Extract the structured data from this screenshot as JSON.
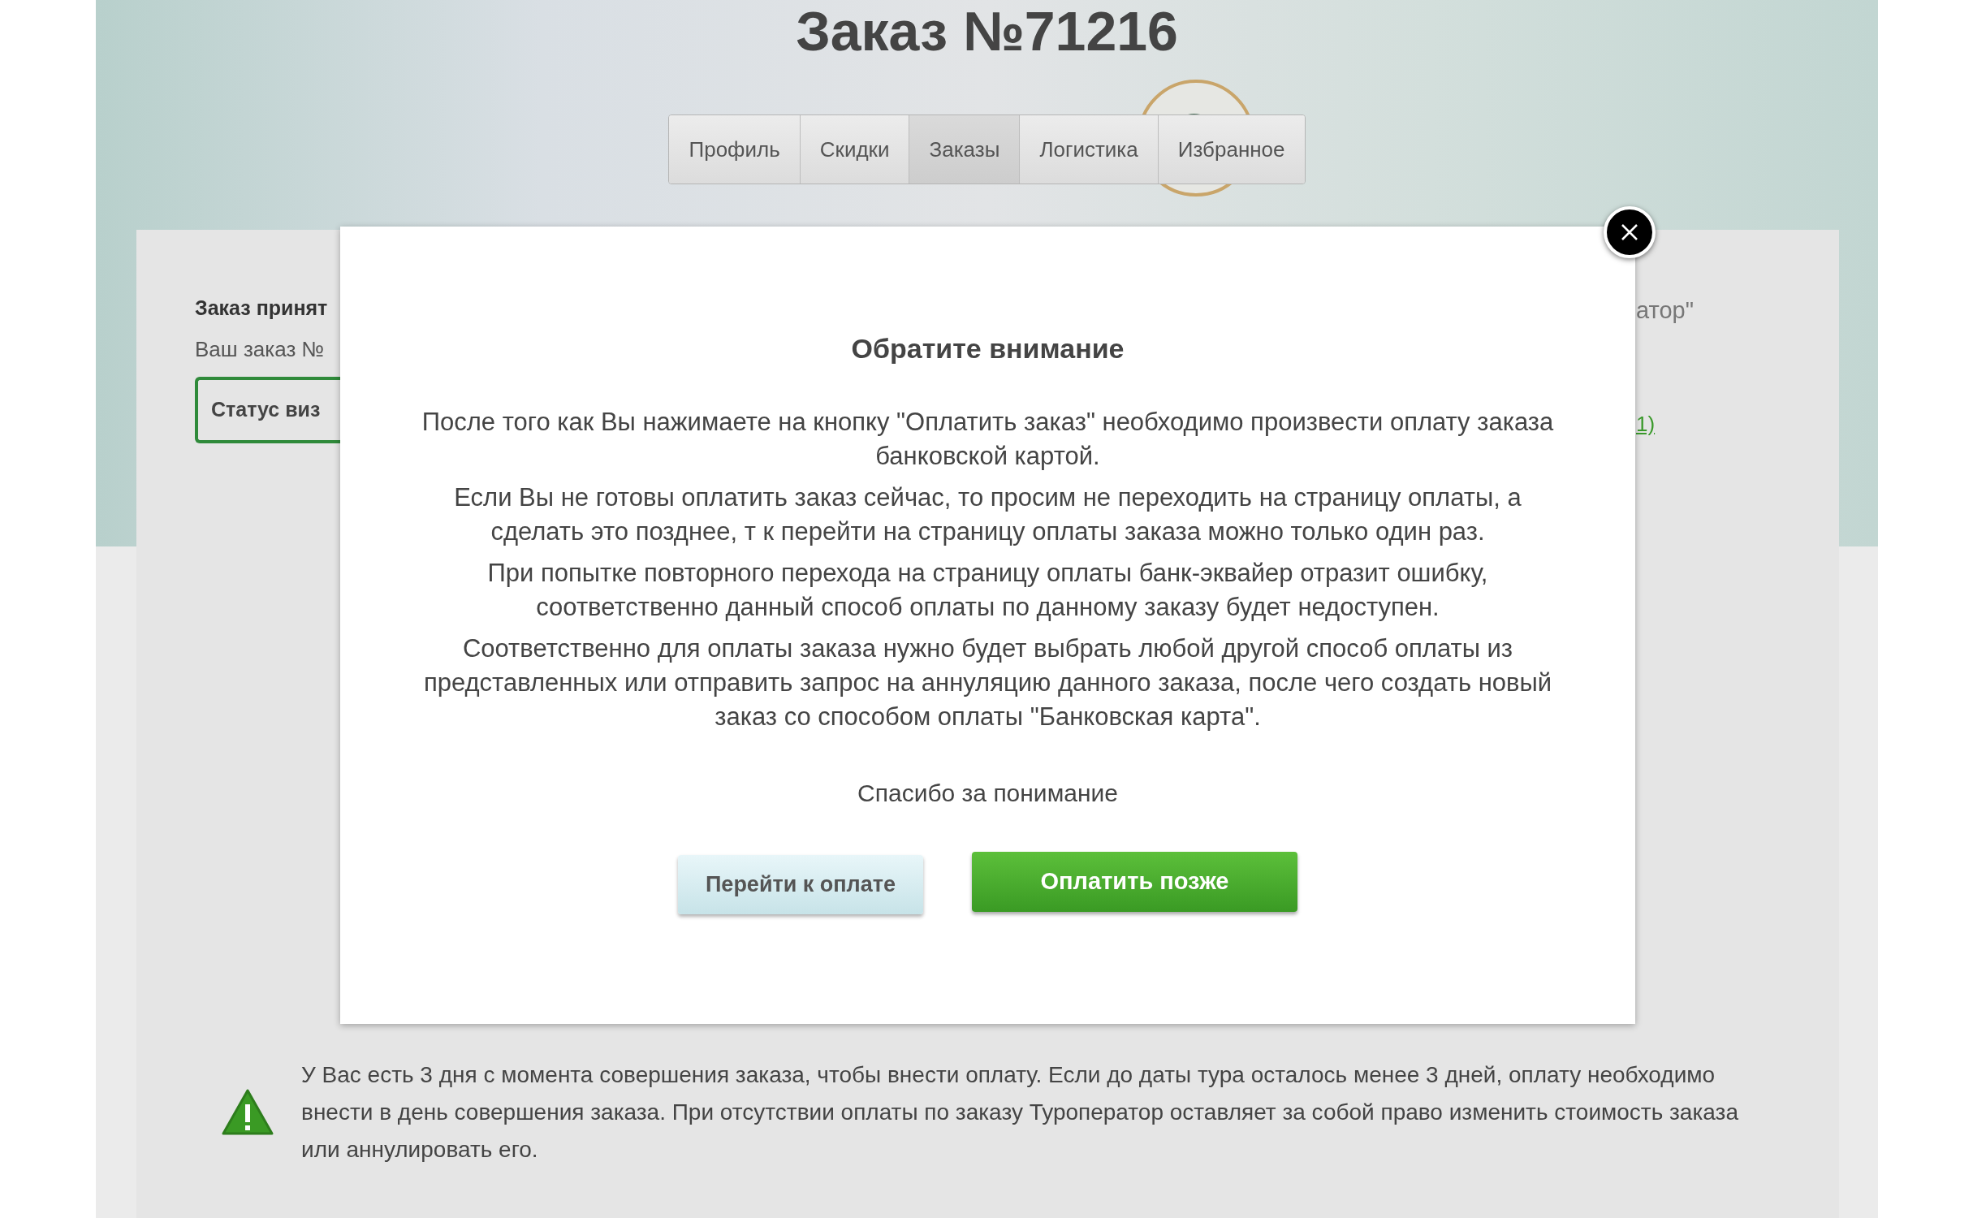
{
  "page": {
    "title": "Заказ №71216"
  },
  "tabs": [
    {
      "label": "Профиль",
      "selected": false
    },
    {
      "label": "Скидки",
      "selected": false
    },
    {
      "label": "Заказы",
      "selected": true
    },
    {
      "label": "Логистика",
      "selected": false
    },
    {
      "label": "Избранное",
      "selected": false
    }
  ],
  "order_card": {
    "status_heading": "Заказ принят",
    "order_line": "Ваш заказ №",
    "visa_button": "Статус виз",
    "right_text": "атор\"",
    "right_link": "1)",
    "warning": "У Вас есть 3 дня с момента совершения заказа, чтобы внести оплату. Если до даты тура осталось менее 3 дней, оплату необходимо внести в день совершения заказа. При отсутствии оплаты по заказу Туроператор оставляет за собой право изменить стоимость заказа или аннулировать его."
  },
  "dialog": {
    "title": "Обратите внимание",
    "paragraphs": [
      "После того как Вы нажимаете на кнопку \"Оплатить заказ\" необходимо произвести оплату заказа банковской картой.",
      "Если Вы не готовы оплатить заказ сейчас, то просим не переходить на страницу оплаты, а сделать это позднее, т к перейти на страницу оплаты заказа можно только один раз.",
      "При попытке повторного перехода на страницу оплаты банк-эквайер отразит ошибку, соответственно данный способ оплаты по данному заказу будет недоступен.",
      "Соответственно для оплаты заказа нужно будет выбрать любой другой способ оплаты из представленных или отправить запрос на аннуляцию данного заказа, после чего создать новый заказ со способом оплаты \"Банковская карта\"."
    ],
    "thanks": "Спасибо за понимание",
    "buttons": [
      {
        "label": "Перейти к оплате",
        "kind": "secondary"
      },
      {
        "label": "Оплатить позже",
        "kind": "primary"
      }
    ]
  }
}
